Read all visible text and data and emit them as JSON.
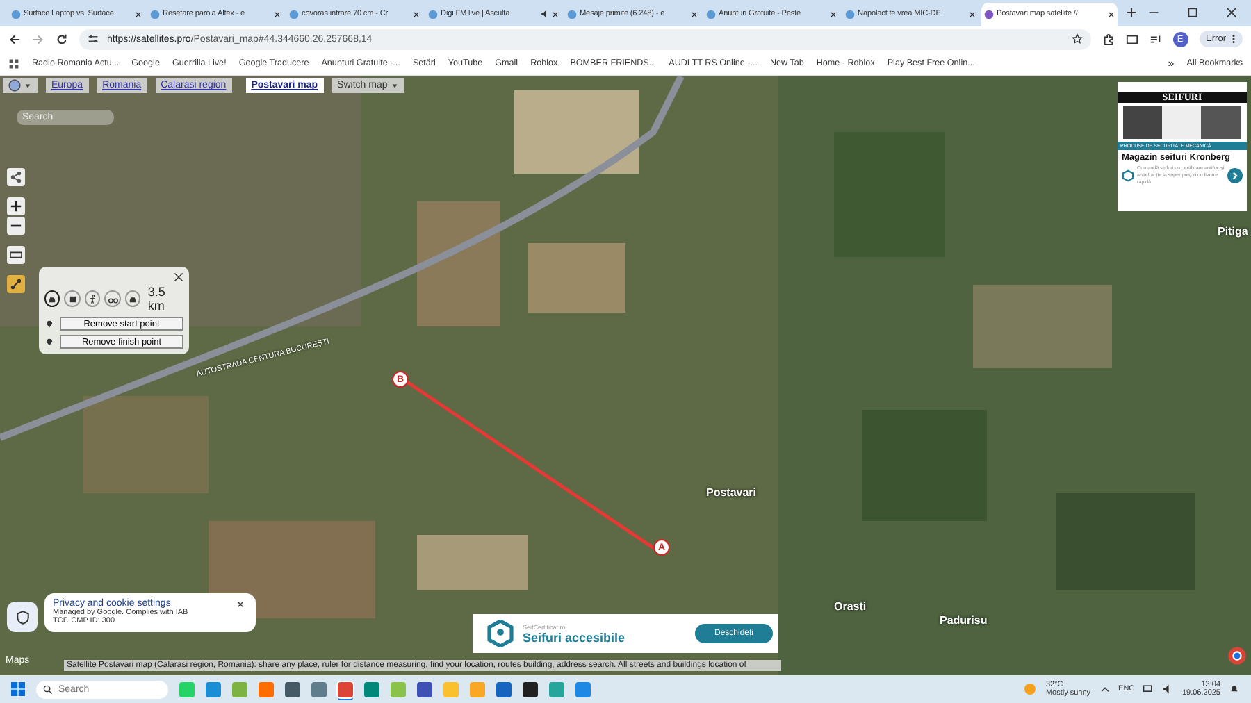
{
  "tabs": [
    {
      "title": "Surface Laptop vs. Surface",
      "selected": false,
      "audio": false
    },
    {
      "title": "Resetare parola Altex - e",
      "selected": false,
      "audio": false
    },
    {
      "title": "covoras intrare 70 cm - Cr",
      "selected": false,
      "audio": false
    },
    {
      "title": "Digi FM live | Asculta",
      "selected": false,
      "audio": true
    },
    {
      "title": "Mesaje primite (6.248) - e",
      "selected": false,
      "audio": false
    },
    {
      "title": "Anunturi Gratuite - Peste",
      "selected": false,
      "audio": false
    },
    {
      "title": "Napolact te vrea MIC-DE",
      "selected": false,
      "audio": false
    },
    {
      "title": "Postavari map satellite //",
      "selected": true,
      "audio": false
    }
  ],
  "address": {
    "host": "https://satellites.pro",
    "path": "/Postavari_map#44.344660,26.257668,14"
  },
  "profile": {
    "initial": "E",
    "status": "Error"
  },
  "bookmarks": [
    "Radio Romania Actu...",
    "Google",
    "Guerrilla Live!",
    "Google Traducere",
    "Anunturi Gratuite -...",
    "Setări",
    "YouTube",
    "Gmail",
    "Roblox",
    "BOMBER FRIENDS...",
    "AUDI TT RS Online -...",
    "New Tab",
    "Home - Roblox",
    "Play Best Free Onlin..."
  ],
  "bookmarks_more": "»",
  "all_bookmarks": "All Bookmarks",
  "breadcrumb": [
    {
      "label": "Europa",
      "selected": false
    },
    {
      "label": "Romania",
      "selected": false
    },
    {
      "label": "Calarasi region",
      "selected": false
    },
    {
      "label": "Postavari map",
      "selected": true
    }
  ],
  "switch_map": "Switch map",
  "map_search": {
    "placeholder": "Search"
  },
  "route": {
    "modes": [
      {
        "kind": "car",
        "selected": true
      },
      {
        "kind": "bus",
        "selected": false
      },
      {
        "kind": "walk",
        "selected": false
      },
      {
        "kind": "bike",
        "selected": false
      },
      {
        "kind": "car",
        "selected": false
      }
    ],
    "distance": "3.5 km",
    "remove_start": "Remove start point",
    "remove_finish": "Remove finish point",
    "start": "A",
    "finish": "B"
  },
  "places": [
    "Postavari",
    "Orasti",
    "Padurisu",
    "Pitiga"
  ],
  "road_label": "AUTOSTRADA CENTURA BUCUREȘTI",
  "side_ad": {
    "banner": "SEIFURI",
    "strip": "PRODUSE DE SECURITATE MECANICĂ",
    "title": "Magazin seifuri Kronberg",
    "text": "Comandă seifuri cu certificare antifoc și antiefracție la super prețuri cu livrare rapidă"
  },
  "cookie": {
    "title": "Privacy and cookie settings",
    "text": "Managed by Google. Complies with IAB TCF. CMP ID: 300"
  },
  "bottom_ad": {
    "site": "SeifCertificat.ro",
    "title": "Seifuri accesibile",
    "button": "Deschideți"
  },
  "maps_logo": "Maps",
  "status_text": "Satellite Postavari map (Calarasi region, Romania): share any place, ruler for distance measuring, find your location, routes building, address search. All streets and buildings location of",
  "taskbar": {
    "search": {
      "placeholder": "Search"
    },
    "apps": [
      {
        "color": "#25d366"
      },
      {
        "color": "#1b8fd6"
      },
      {
        "color": "#7cb342"
      },
      {
        "color": "#ff6d00"
      },
      {
        "color": "#455a64"
      },
      {
        "color": "#607d8b"
      },
      {
        "color": "#db4437",
        "selected": true
      },
      {
        "color": "#00897b"
      },
      {
        "color": "#8bc34a"
      },
      {
        "color": "#3f51b5"
      },
      {
        "color": "#fbc02d"
      },
      {
        "color": "#f9a825"
      },
      {
        "color": "#1565c0"
      },
      {
        "color": "#212121"
      },
      {
        "color": "#26a69a"
      },
      {
        "color": "#1e88e5"
      }
    ],
    "temperature": "32°C",
    "weather": "Mostly sunny",
    "language": "ENG",
    "time": "13:04",
    "date": "19.06.2025"
  }
}
